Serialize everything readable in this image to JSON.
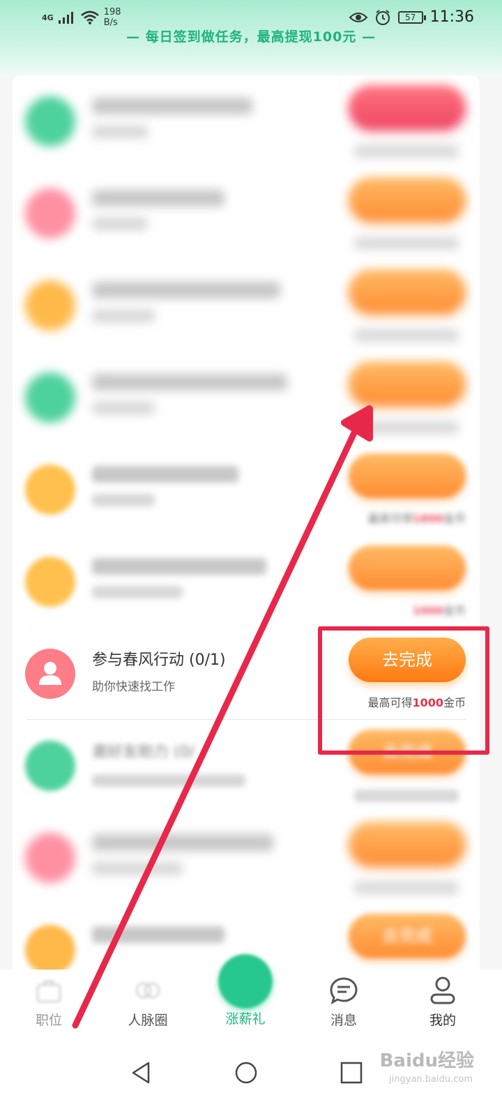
{
  "status_bar": {
    "network": "4G",
    "speed_value": "198",
    "speed_unit": "B/s",
    "battery": "57",
    "time": "11:36"
  },
  "banner": {
    "text": "— 每日签到做任务，最高提现100元 —"
  },
  "tasks": [
    {
      "title": "",
      "subtitle": "",
      "button": "",
      "reward_prefix": "",
      "reward_amount": "",
      "reward_suffix": "",
      "icon": "green-task-icon",
      "color": "#2fc98c"
    },
    {
      "title": "",
      "subtitle": "",
      "button": "",
      "reward_prefix": "",
      "reward_amount": "",
      "reward_suffix": "",
      "icon": "pink-task-icon",
      "color": "#ff7d93"
    },
    {
      "title": "",
      "subtitle": "",
      "button": "",
      "reward_prefix": "",
      "reward_amount": "",
      "reward_suffix": "",
      "icon": "orange-task-icon",
      "color": "#ffad2a"
    },
    {
      "title": "",
      "subtitle": "",
      "button": "",
      "reward_prefix": "",
      "reward_amount": "",
      "reward_suffix": "",
      "icon": "green-task-icon",
      "color": "#2fc98c"
    },
    {
      "title": "",
      "subtitle": "",
      "button": "",
      "reward_prefix": "最高可得",
      "reward_amount": "1800",
      "reward_suffix": "金币",
      "icon": "orange-task-icon",
      "color": "#ffb62e"
    },
    {
      "title": "",
      "subtitle": "",
      "button": "",
      "reward_prefix": "",
      "reward_amount": "1000",
      "reward_suffix": "金币",
      "icon": "orange-task-icon",
      "color": "#ffb62e"
    },
    {
      "title": "参与春风行动 (0/1)",
      "subtitle": "助你快速找工作",
      "button": "去完成",
      "reward_prefix": "最高可得",
      "reward_amount": "1000",
      "reward_suffix": "金币",
      "icon": "person-icon",
      "color": "#ff7d86"
    },
    {
      "title": "邀好友助力 (0/",
      "subtitle": "",
      "button": "去完成",
      "reward_prefix": "",
      "reward_amount": "",
      "reward_suffix": "",
      "icon": "thumbs-up-icon",
      "color": "#2fc98c"
    },
    {
      "title": "",
      "subtitle": "",
      "button": "",
      "reward_prefix": "",
      "reward_amount": "",
      "reward_suffix": "",
      "icon": "pink-task-icon",
      "color": "#ff7d93"
    },
    {
      "title": "",
      "subtitle": "",
      "button": "去完成",
      "reward_prefix": "",
      "reward_amount": "",
      "reward_suffix": "",
      "icon": "orange-task-icon",
      "color": "#ffad2a"
    }
  ],
  "tab_bar": {
    "tabs": [
      {
        "label": "职位",
        "icon": "briefcase-icon"
      },
      {
        "label": "人脉圈",
        "icon": "circles-icon"
      },
      {
        "label": "涨薪礼",
        "icon": "gift-icon",
        "active": true
      },
      {
        "label": "消息",
        "icon": "message-icon"
      },
      {
        "label": "我的",
        "icon": "profile-icon"
      }
    ]
  },
  "watermark": {
    "logo": "Baidu经验",
    "url": "jingyan.baidu.com"
  },
  "colors": {
    "accent_green": "#1fb37e",
    "button_orange": "#ff8a1e",
    "highlight_red": "#e8284a",
    "reward_red": "#e8334a"
  }
}
